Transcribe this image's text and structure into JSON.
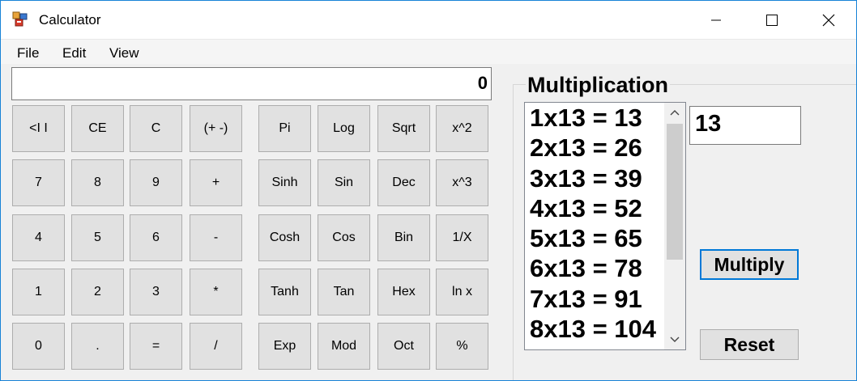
{
  "window": {
    "title": "Calculator"
  },
  "menu": [
    "File",
    "Edit",
    "View"
  ],
  "display": {
    "value": "0"
  },
  "keys": [
    [
      "<I I",
      "CE",
      "C",
      "(+ -)",
      "Pi",
      "Log",
      "Sqrt",
      "x^2"
    ],
    [
      "7",
      "8",
      "9",
      "+",
      "Sinh",
      "Sin",
      "Dec",
      "x^3"
    ],
    [
      "4",
      "5",
      "6",
      "-",
      "Cosh",
      "Cos",
      "Bin",
      "1/X"
    ],
    [
      "1",
      "2",
      "3",
      "*",
      "Tanh",
      "Tan",
      "Hex",
      "ln x"
    ],
    [
      "0",
      ".",
      "=",
      "/",
      "Exp",
      "Mod",
      "Oct",
      "%"
    ]
  ],
  "multiplication": {
    "title": "Multiplication",
    "input_value": "13",
    "list": [
      "1x13 = 13",
      "2x13 = 26",
      "3x13 = 39",
      "4x13 = 52",
      "5x13 = 65",
      "6x13 = 78",
      "7x13 = 91",
      "8x13 = 104"
    ],
    "multiply_label": "Multiply",
    "reset_label": "Reset"
  }
}
